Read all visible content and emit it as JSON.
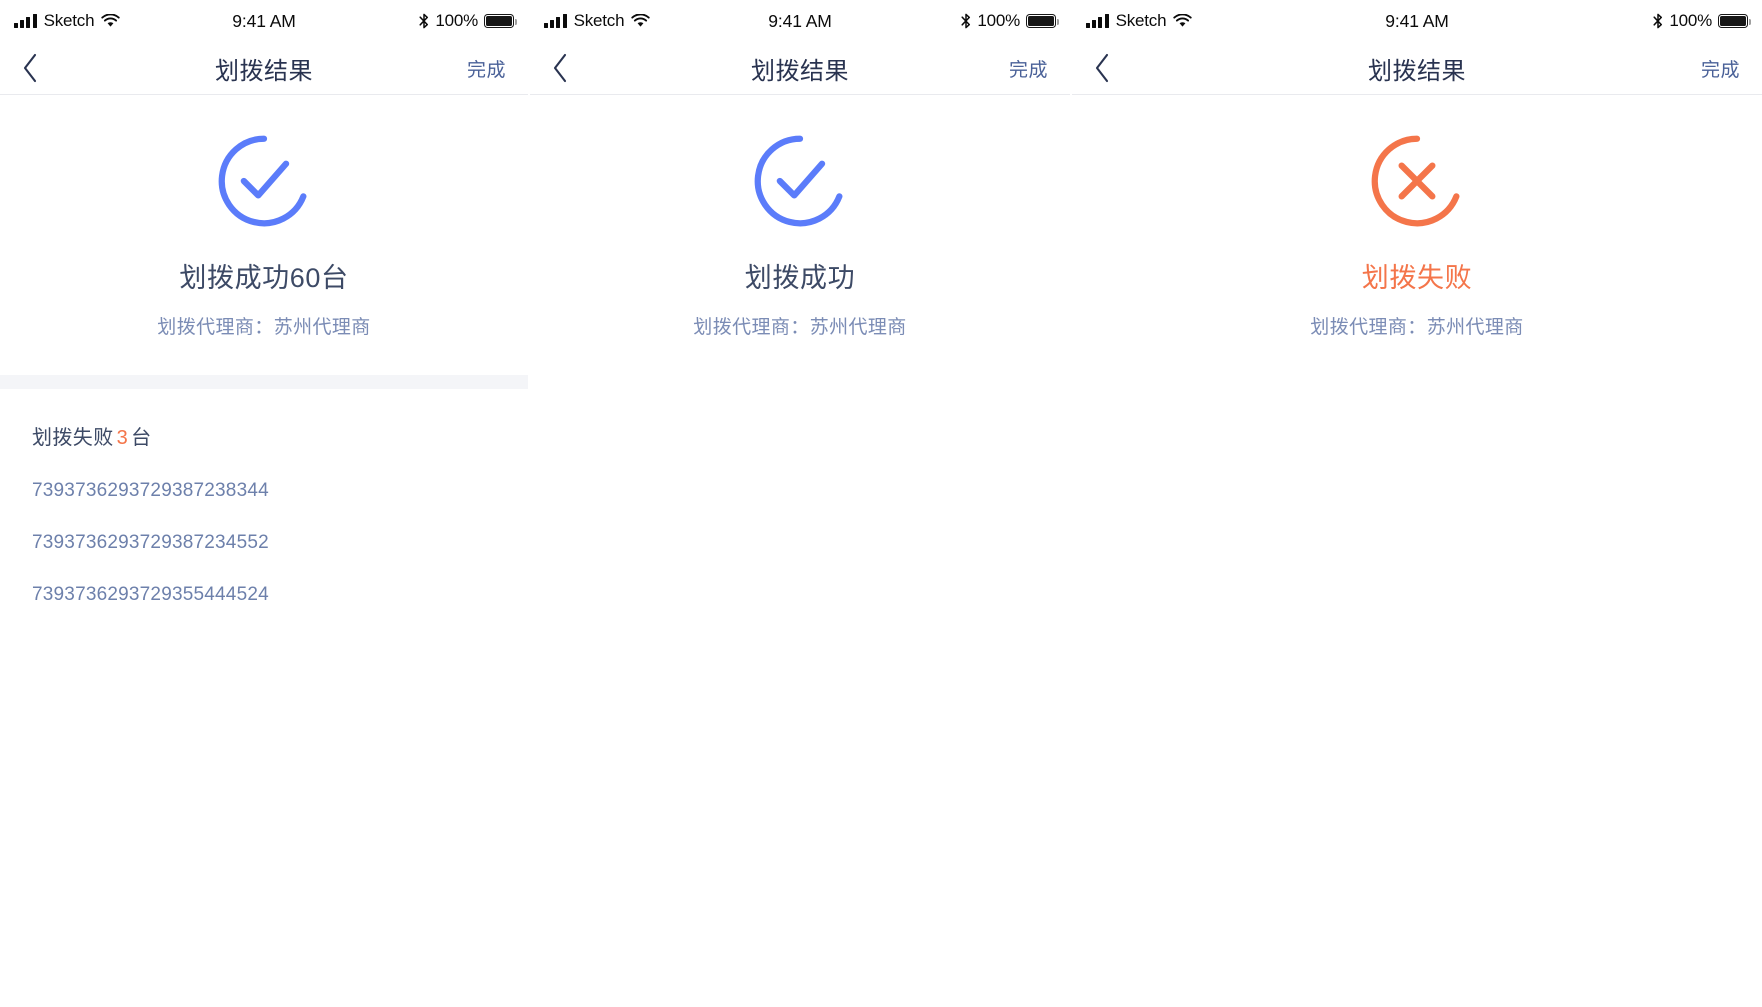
{
  "status_bar": {
    "carrier": "Sketch",
    "time": "9:41 AM",
    "battery_pct": "100%",
    "icons": {
      "signal": "signal-bars-icon",
      "wifi": "wifi-icon",
      "bluetooth": "bluetooth-icon",
      "battery": "battery-icon"
    }
  },
  "nav": {
    "back": "back-chevron-icon",
    "title": "划拨结果",
    "action": "完成"
  },
  "colors": {
    "blue_accent": "#5b7cfa",
    "orange_accent": "#f4754a",
    "title_text": "#293350",
    "body_text": "#3d4a66",
    "sub_text": "#7b8cb5",
    "link_text": "#4a6198",
    "divider_band": "#f4f5f8"
  },
  "panels": [
    {
      "id": "panel-success-with-failures",
      "status": "success",
      "icon": "check-circle-icon",
      "title": "划拨成功60台",
      "subtitle": "划拨代理商：苏州代理商",
      "failure_section": {
        "label_prefix": "划拨失败",
        "count": "3",
        "label_suffix": "台",
        "items": [
          "7393736293729387238344",
          "7393736293729387234552",
          "7393736293729355444524"
        ]
      }
    },
    {
      "id": "panel-success",
      "status": "success",
      "icon": "check-circle-icon",
      "title": "划拨成功",
      "subtitle": "划拨代理商：苏州代理商",
      "failure_section": null
    },
    {
      "id": "panel-failure",
      "status": "failure",
      "icon": "x-circle-icon",
      "title": "划拨失败",
      "subtitle": "划拨代理商：苏州代理商",
      "failure_section": null
    }
  ]
}
